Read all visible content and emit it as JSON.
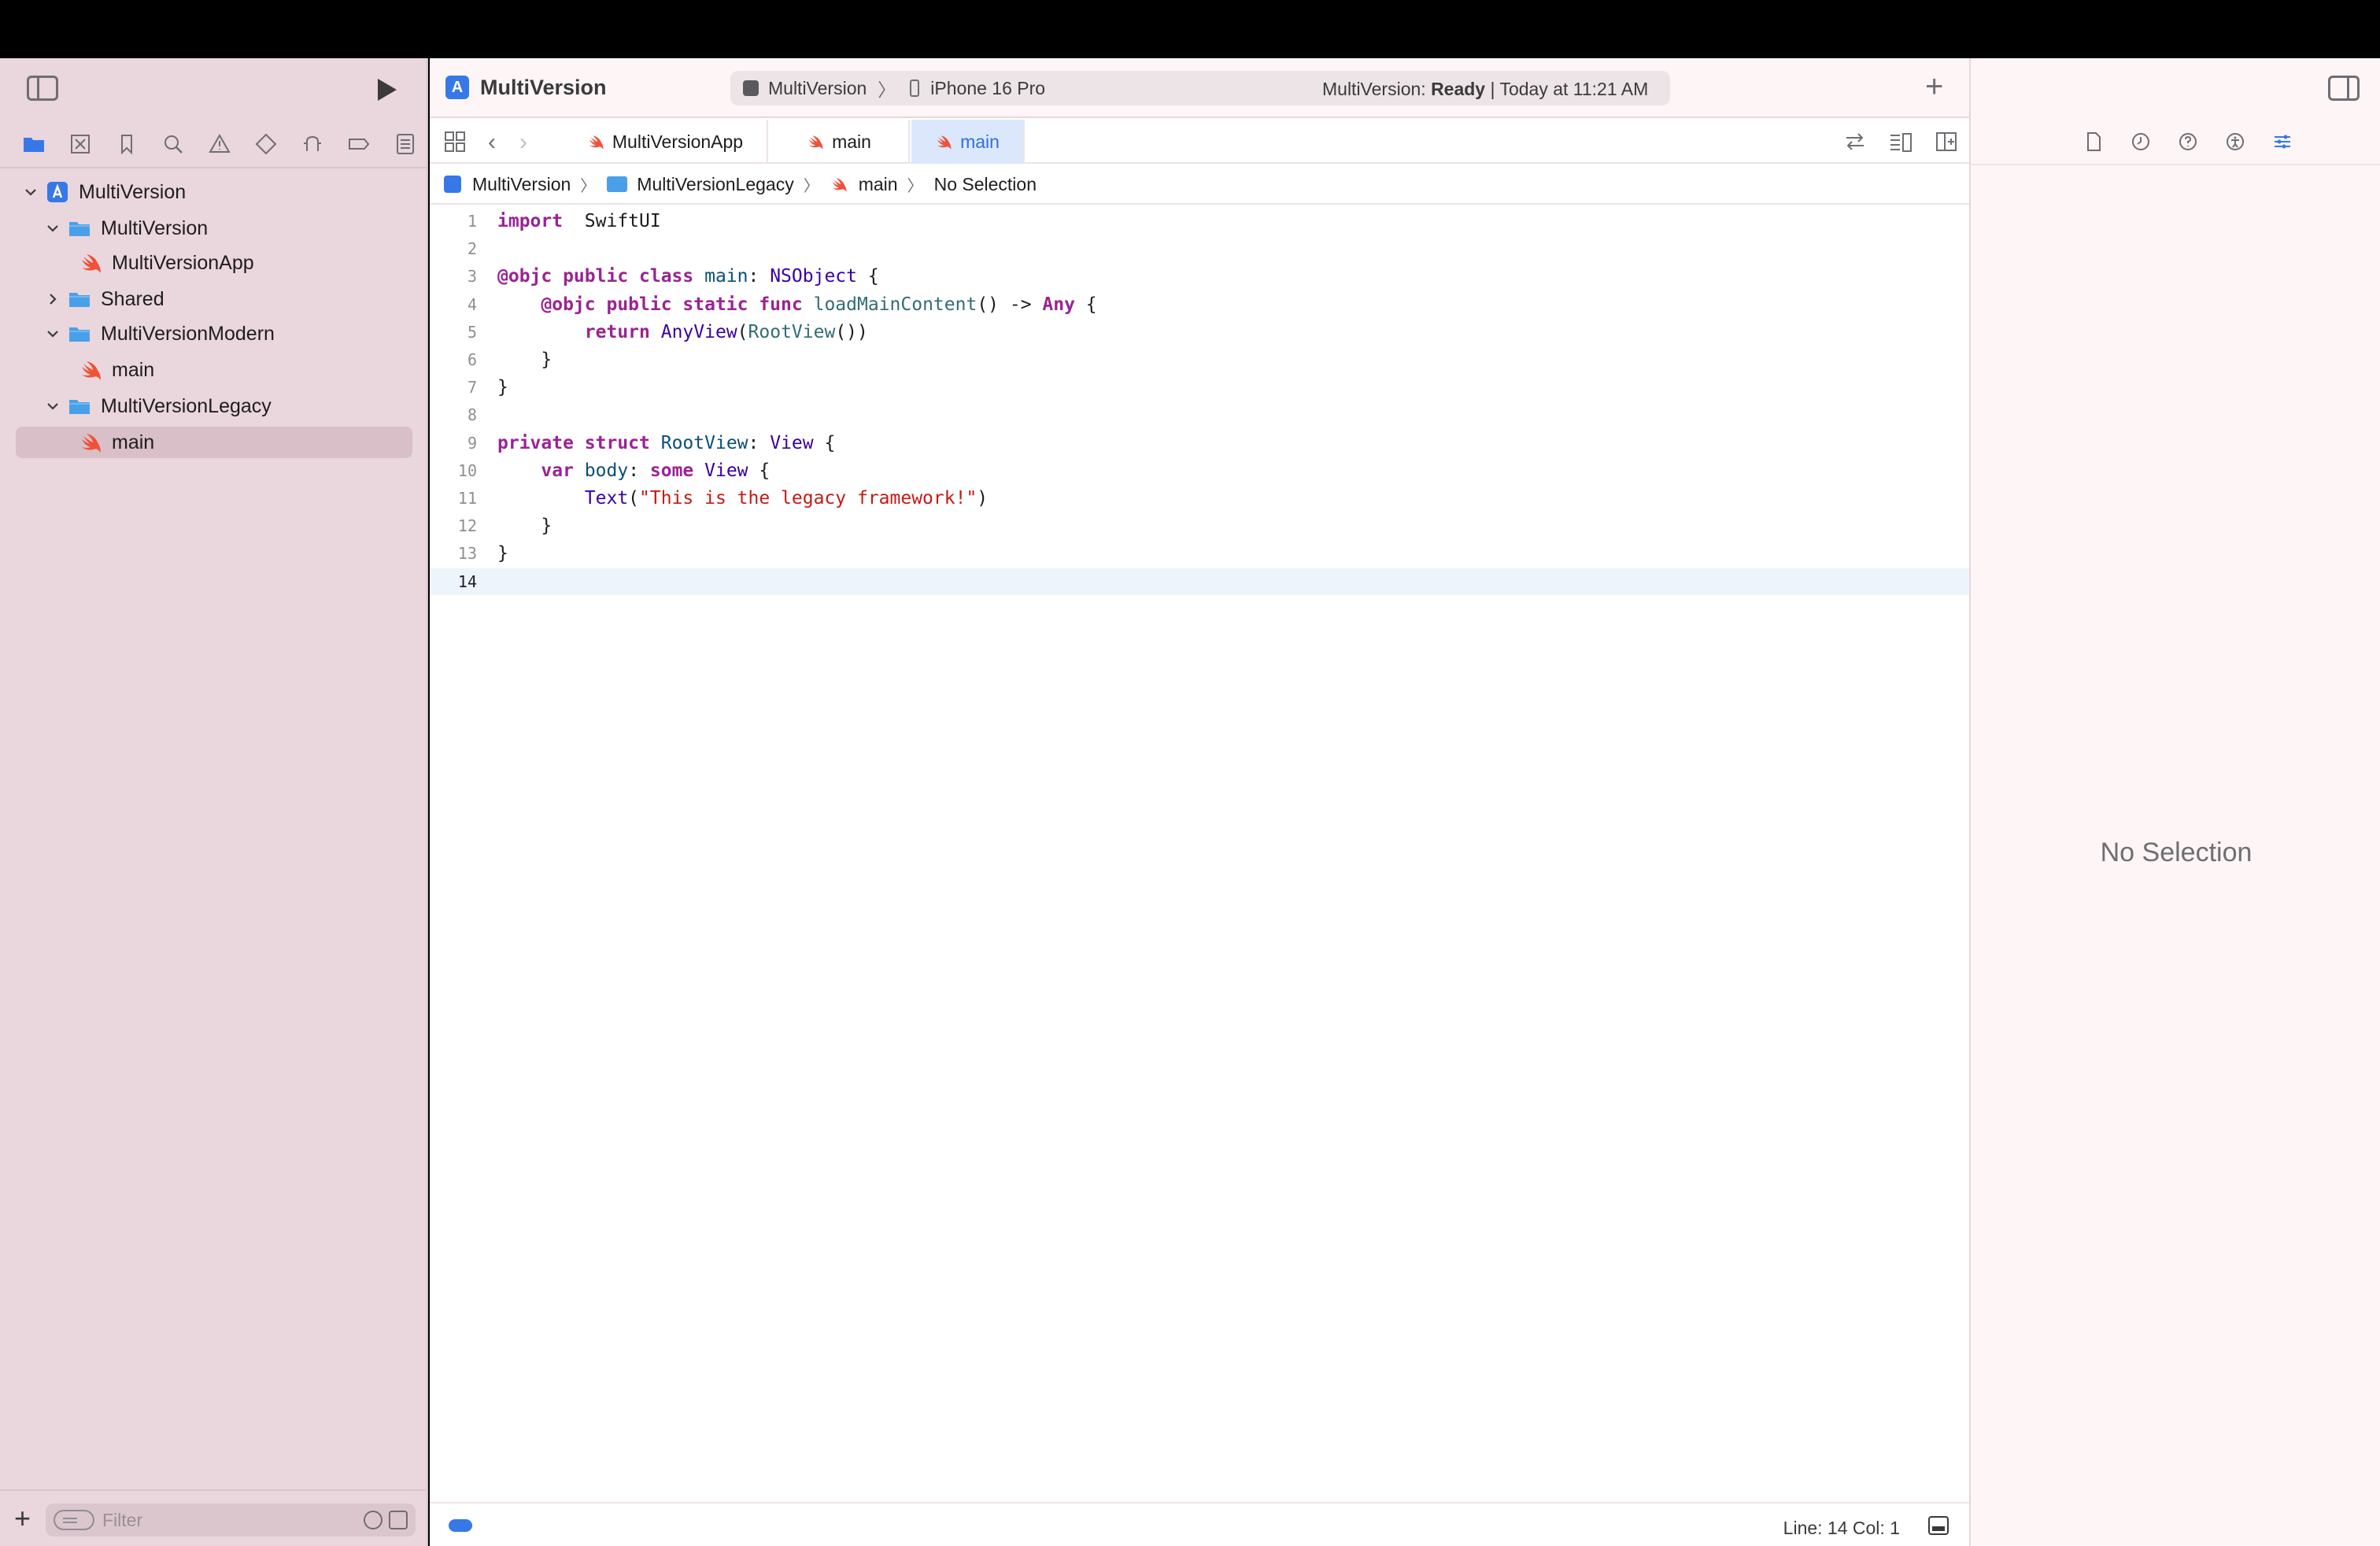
{
  "window": {
    "project_title": "MultiVersion",
    "add_label": "+"
  },
  "scheme": {
    "target": "MultiVersion",
    "separator": "〉",
    "device": "iPhone 16 Pro"
  },
  "activity": {
    "prefix": "MultiVersion: ",
    "state": "Ready",
    "suffix": " | Today at 11:21 AM"
  },
  "navigator": {
    "tabs": [
      "folder-icon",
      "source-control-icon",
      "bookmark-icon",
      "find-icon",
      "issue-icon",
      "test-icon",
      "debug-icon",
      "breakpoint-icon",
      "report-icon"
    ],
    "tree": [
      {
        "label": "MultiVersion",
        "kind": "project",
        "level": 0,
        "expanded": true
      },
      {
        "label": "MultiVersion",
        "kind": "folder",
        "level": 1,
        "expanded": true
      },
      {
        "label": "MultiVersionApp",
        "kind": "swift",
        "level": 2
      },
      {
        "label": "Shared",
        "kind": "folder",
        "level": 1,
        "expanded": false
      },
      {
        "label": "MultiVersionModern",
        "kind": "folder",
        "level": 1,
        "expanded": true
      },
      {
        "label": "main",
        "kind": "swift",
        "level": 2
      },
      {
        "label": "MultiVersionLegacy",
        "kind": "folder",
        "level": 1,
        "expanded": true
      },
      {
        "label": "main",
        "kind": "swift",
        "level": 2,
        "selected": true
      }
    ],
    "filter_placeholder": "Filter"
  },
  "tabs": [
    {
      "label": "MultiVersionApp",
      "active": false
    },
    {
      "label": "main",
      "active": false
    },
    {
      "label": "main",
      "active": true
    }
  ],
  "jumpbar": {
    "items": [
      "MultiVersion",
      "MultiVersionLegacy",
      "main",
      "No Selection"
    ],
    "chevron": "〉"
  },
  "code": {
    "current_line": 14,
    "lines": [
      [
        [
          "kw",
          "import"
        ],
        [
          "",
          "  SwiftUI"
        ]
      ],
      [],
      [
        [
          "kw",
          "@objc public class"
        ],
        [
          "",
          " "
        ],
        [
          "tyd",
          "main"
        ],
        [
          "",
          ": "
        ],
        [
          "ty",
          "NSObject"
        ],
        [
          "",
          " {"
        ]
      ],
      [
        [
          "",
          "    "
        ],
        [
          "kw",
          "@objc public static func"
        ],
        [
          "",
          " "
        ],
        [
          "fn",
          "loadMainContent"
        ],
        [
          "",
          "() -> "
        ],
        [
          "kw",
          "Any"
        ],
        [
          "",
          " {"
        ]
      ],
      [
        [
          "",
          "        "
        ],
        [
          "kw",
          "return"
        ],
        [
          "",
          " "
        ],
        [
          "ty",
          "AnyView"
        ],
        [
          "",
          "("
        ],
        [
          "fn",
          "RootView"
        ],
        [
          "",
          "())"
        ]
      ],
      [
        [
          "",
          "    }"
        ]
      ],
      [
        [
          "",
          "}"
        ]
      ],
      [],
      [
        [
          "kw",
          "private struct"
        ],
        [
          "",
          " "
        ],
        [
          "tyd",
          "RootView"
        ],
        [
          "",
          ": "
        ],
        [
          "ty",
          "View"
        ],
        [
          "",
          " {"
        ]
      ],
      [
        [
          "",
          "    "
        ],
        [
          "kw",
          "var"
        ],
        [
          "",
          " "
        ],
        [
          "tyd",
          "body"
        ],
        [
          "",
          ": "
        ],
        [
          "kw",
          "some"
        ],
        [
          "",
          " "
        ],
        [
          "ty",
          "View"
        ],
        [
          "",
          " {"
        ]
      ],
      [
        [
          "",
          "        "
        ],
        [
          "ty",
          "Text"
        ],
        [
          "",
          "("
        ],
        [
          "str",
          "\"This is the legacy framework!\""
        ],
        [
          "",
          ")"
        ]
      ],
      [
        [
          "",
          "    }"
        ]
      ],
      [
        [
          "",
          "}"
        ]
      ],
      []
    ]
  },
  "status": {
    "cursor": "Line: 14  Col: 1"
  },
  "inspector": {
    "empty_label": "No Selection"
  },
  "colors": {
    "accent": "#3778e8",
    "navigator_bg": "#ead6dd",
    "swift_orange": "#f05138",
    "folder_blue": "#4aa0e8"
  }
}
